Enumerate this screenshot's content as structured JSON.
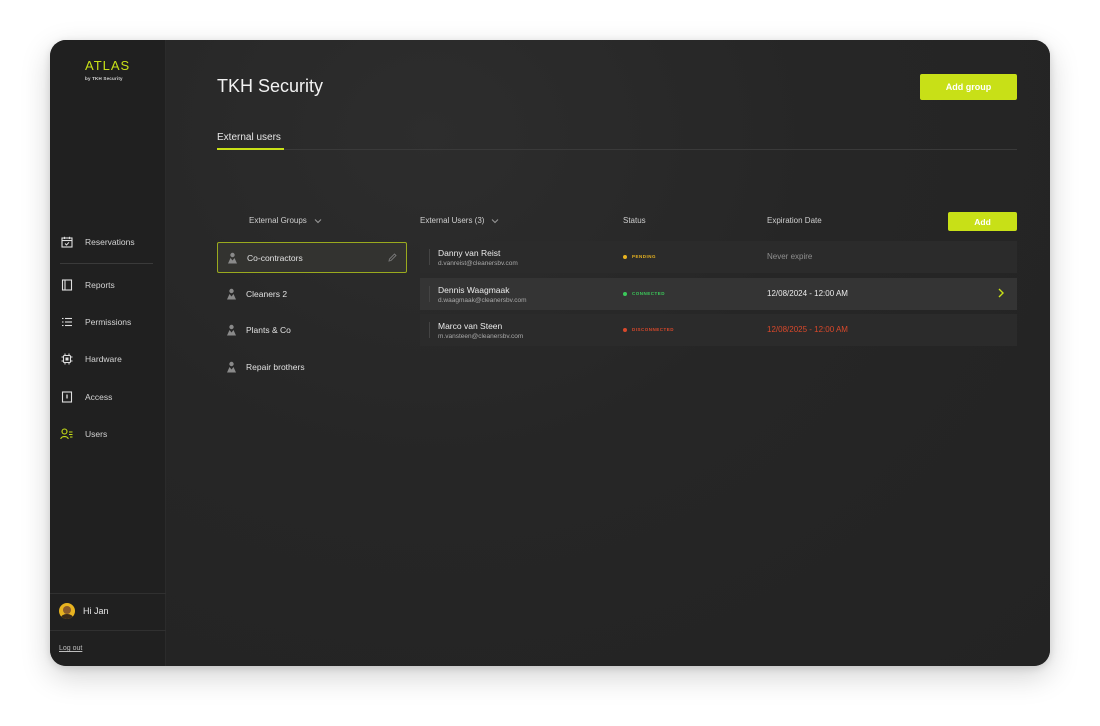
{
  "app": {
    "logo_title": "ATLAS",
    "logo_subtitle": "by TKH Security",
    "accent": "#c8e017"
  },
  "sidebar": {
    "items": [
      {
        "label": "Reservations",
        "icon": "calendar-icon"
      },
      {
        "label": "Reports",
        "icon": "book-icon"
      },
      {
        "label": "Permissions",
        "icon": "list-icon"
      },
      {
        "label": "Hardware",
        "icon": "chip-icon"
      },
      {
        "label": "Access",
        "icon": "door-icon"
      },
      {
        "label": "Users",
        "icon": "users-icon",
        "active": true
      }
    ],
    "greeting": "Hi Jan",
    "logout": "Log out"
  },
  "header": {
    "title": "TKH Security",
    "add_group": "Add group"
  },
  "tabs": {
    "external_users": "External users"
  },
  "groups": {
    "header": "External Groups",
    "items": [
      {
        "label": "Co-contractors",
        "selected": true
      },
      {
        "label": "Cleaners 2"
      },
      {
        "label": "Plants & Co"
      },
      {
        "label": "Repair brothers"
      }
    ]
  },
  "users": {
    "header": "External Users (3)",
    "status_header": "Status",
    "expiration_header": "Expiration Date",
    "add": "Add",
    "rows": [
      {
        "name": "Danny van Reist",
        "email": "d.vanreist@cleanersbv.com",
        "status": "PENDING",
        "status_color": "#e8b320",
        "expiration": "Never expire",
        "exp_color": "#8f8f8f"
      },
      {
        "name": "Dennis Waagmaak",
        "email": "d.waagmaak@cleanersbv.com",
        "status": "CONNECTED",
        "status_color": "#3bc95a",
        "expiration": "12/08/2024 - 12:00 AM",
        "exp_color": "#ececec"
      },
      {
        "name": "Marco van Steen",
        "email": "m.vansteen@cleanersbv.com",
        "status": "DISCONNECTED",
        "status_color": "#d9482b",
        "expiration": "12/08/2025 - 12:00 AM",
        "exp_color": "#d9482b"
      }
    ]
  }
}
